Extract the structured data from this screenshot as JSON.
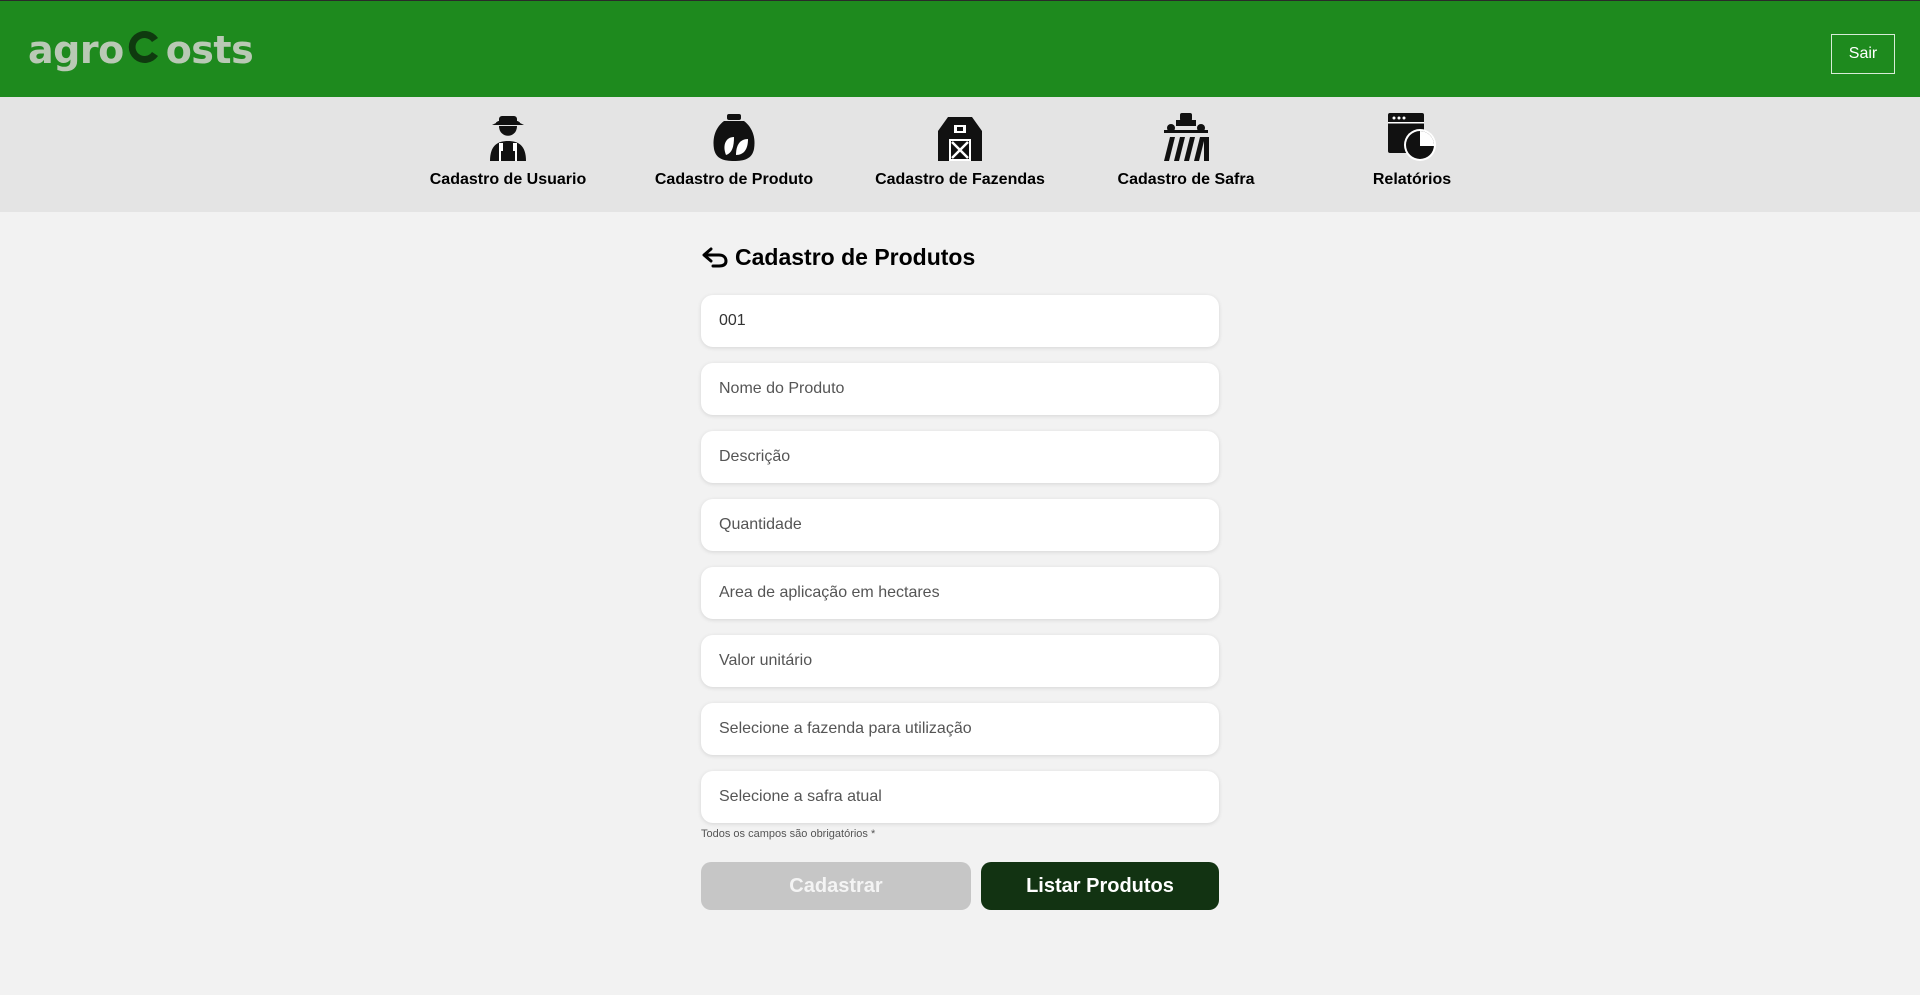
{
  "header": {
    "logo_text_left": "agro",
    "logo_text_right": "osts",
    "logout_label": "Sair",
    "colors": {
      "header_bg": "#1e8a1e",
      "logo_text": "#b9c9b5",
      "logo_c": "#0f3a0f"
    }
  },
  "nav": {
    "items": [
      {
        "label": "Cadastro de Usuario",
        "icon": "farmer-icon"
      },
      {
        "label": "Cadastro de Produto",
        "icon": "seed-bag-icon"
      },
      {
        "label": "Cadastro de Fazendas",
        "icon": "barn-icon"
      },
      {
        "label": "Cadastro de Safra",
        "icon": "tractor-field-icon"
      },
      {
        "label": "Relatórios",
        "icon": "report-chart-icon"
      }
    ]
  },
  "form": {
    "title": "Cadastro de Produtos",
    "back_icon": "back-arrow-icon",
    "fields": {
      "code_value": "001",
      "name_placeholder": "Nome do Produto",
      "description_placeholder": "Descrição",
      "quantity_placeholder": "Quantidade",
      "area_placeholder": "Area de aplicação em hectares",
      "unit_value_placeholder": "Valor unitário",
      "farm_placeholder": "Selecione a fazenda para utilização",
      "harvest_placeholder": "Selecione a safra atual"
    },
    "required_note": "Todos os campos são obrigatórios *",
    "register_label": "Cadastrar",
    "list_label": "Listar Produtos",
    "colors": {
      "register_bg": "#c6c6c6",
      "list_bg": "#123312"
    }
  }
}
